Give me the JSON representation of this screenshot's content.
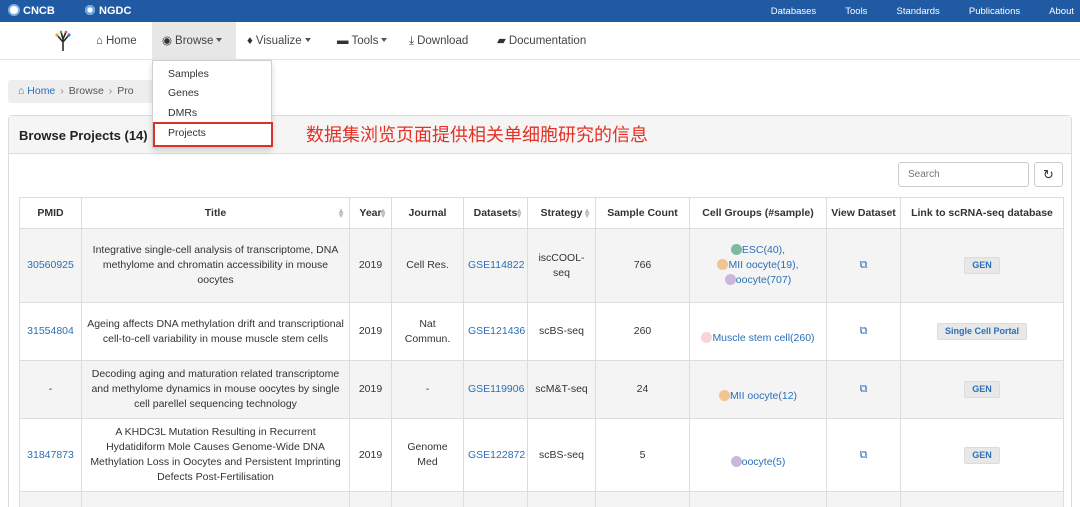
{
  "topbar": {
    "cncb_label": "CNCB",
    "ngdc_label": "NGDC",
    "links": [
      "Databases",
      "Tools",
      "Standards",
      "Publications",
      "About"
    ]
  },
  "nav": {
    "home": "Home",
    "browse": "Browse",
    "visualize": "Visualize",
    "tools": "Tools",
    "download": "Download",
    "documentation": "Documentation"
  },
  "browse_menu": [
    "Samples",
    "Genes",
    "DMRs",
    "Projects"
  ],
  "annotation": "数据集浏览页面提供相关单细胞研究的信息",
  "breadcrumb": {
    "home": "Home",
    "browse": "Browse",
    "current": "Pro"
  },
  "panel": {
    "title": "Browse Projects (14)"
  },
  "search": {
    "placeholder": "Search"
  },
  "table": {
    "headers": [
      "PMID",
      "Title",
      "Year",
      "Journal",
      "Datasets",
      "Strategy",
      "Sample Count",
      "Cell Groups (#sample)",
      "View Dataset",
      "Link to scRNA-seq database"
    ],
    "rows": [
      {
        "pmid": "30560925",
        "title": "Integrative single-cell analysis of transcriptome, DNA methylome and chromatin accessibility in mouse oocytes",
        "year": "2019",
        "journal": "Cell Res.",
        "dataset": "GSE114822",
        "strategy": "iscCOOL-seq",
        "count": "766",
        "groups": [
          {
            "label": "ESC(40),",
            "color": "#7fb9a0"
          },
          {
            "label": "MII oocyte(19),",
            "color": "#f2c48f"
          },
          {
            "label": "oocyte(707)",
            "color": "#c9b7dc"
          }
        ],
        "link": "GEN"
      },
      {
        "pmid": "31554804",
        "title": "Ageing affects DNA methylation drift and transcriptional cell-to-cell variability in mouse muscle stem cells",
        "year": "2019",
        "journal": "Nat Commun.",
        "dataset": "GSE121436",
        "strategy": "scBS-seq",
        "count": "260",
        "groups": [
          {
            "label": "Muscle stem cell(260)",
            "color": "#f7d3dc"
          }
        ],
        "link": "Single Cell Portal"
      },
      {
        "pmid": "-",
        "title": "Decoding aging and maturation related transcriptome and methylome dynamics in mouse oocytes by single cell parellel sequencing technology",
        "year": "2019",
        "journal": "-",
        "dataset": "GSE119906",
        "strategy": "scM&T-seq",
        "count": "24",
        "groups": [
          {
            "label": "MII oocyte(12)",
            "color": "#f2c48f"
          }
        ],
        "link": "GEN"
      },
      {
        "pmid": "31847873",
        "title": "A KHDC3L Mutation Resulting in Recurrent Hydatidiform Mole Causes Genome-Wide DNA Methylation Loss in Oocytes and Persistent Imprinting Defects Post-Fertilisation",
        "year": "2019",
        "journal": "Genome Med",
        "dataset": "GSE122872",
        "strategy": "scBS-seq",
        "count": "5",
        "groups": [
          {
            "label": "oocyte(5)",
            "color": "#c9b7dc"
          }
        ],
        "link": "GEN"
      }
    ]
  }
}
